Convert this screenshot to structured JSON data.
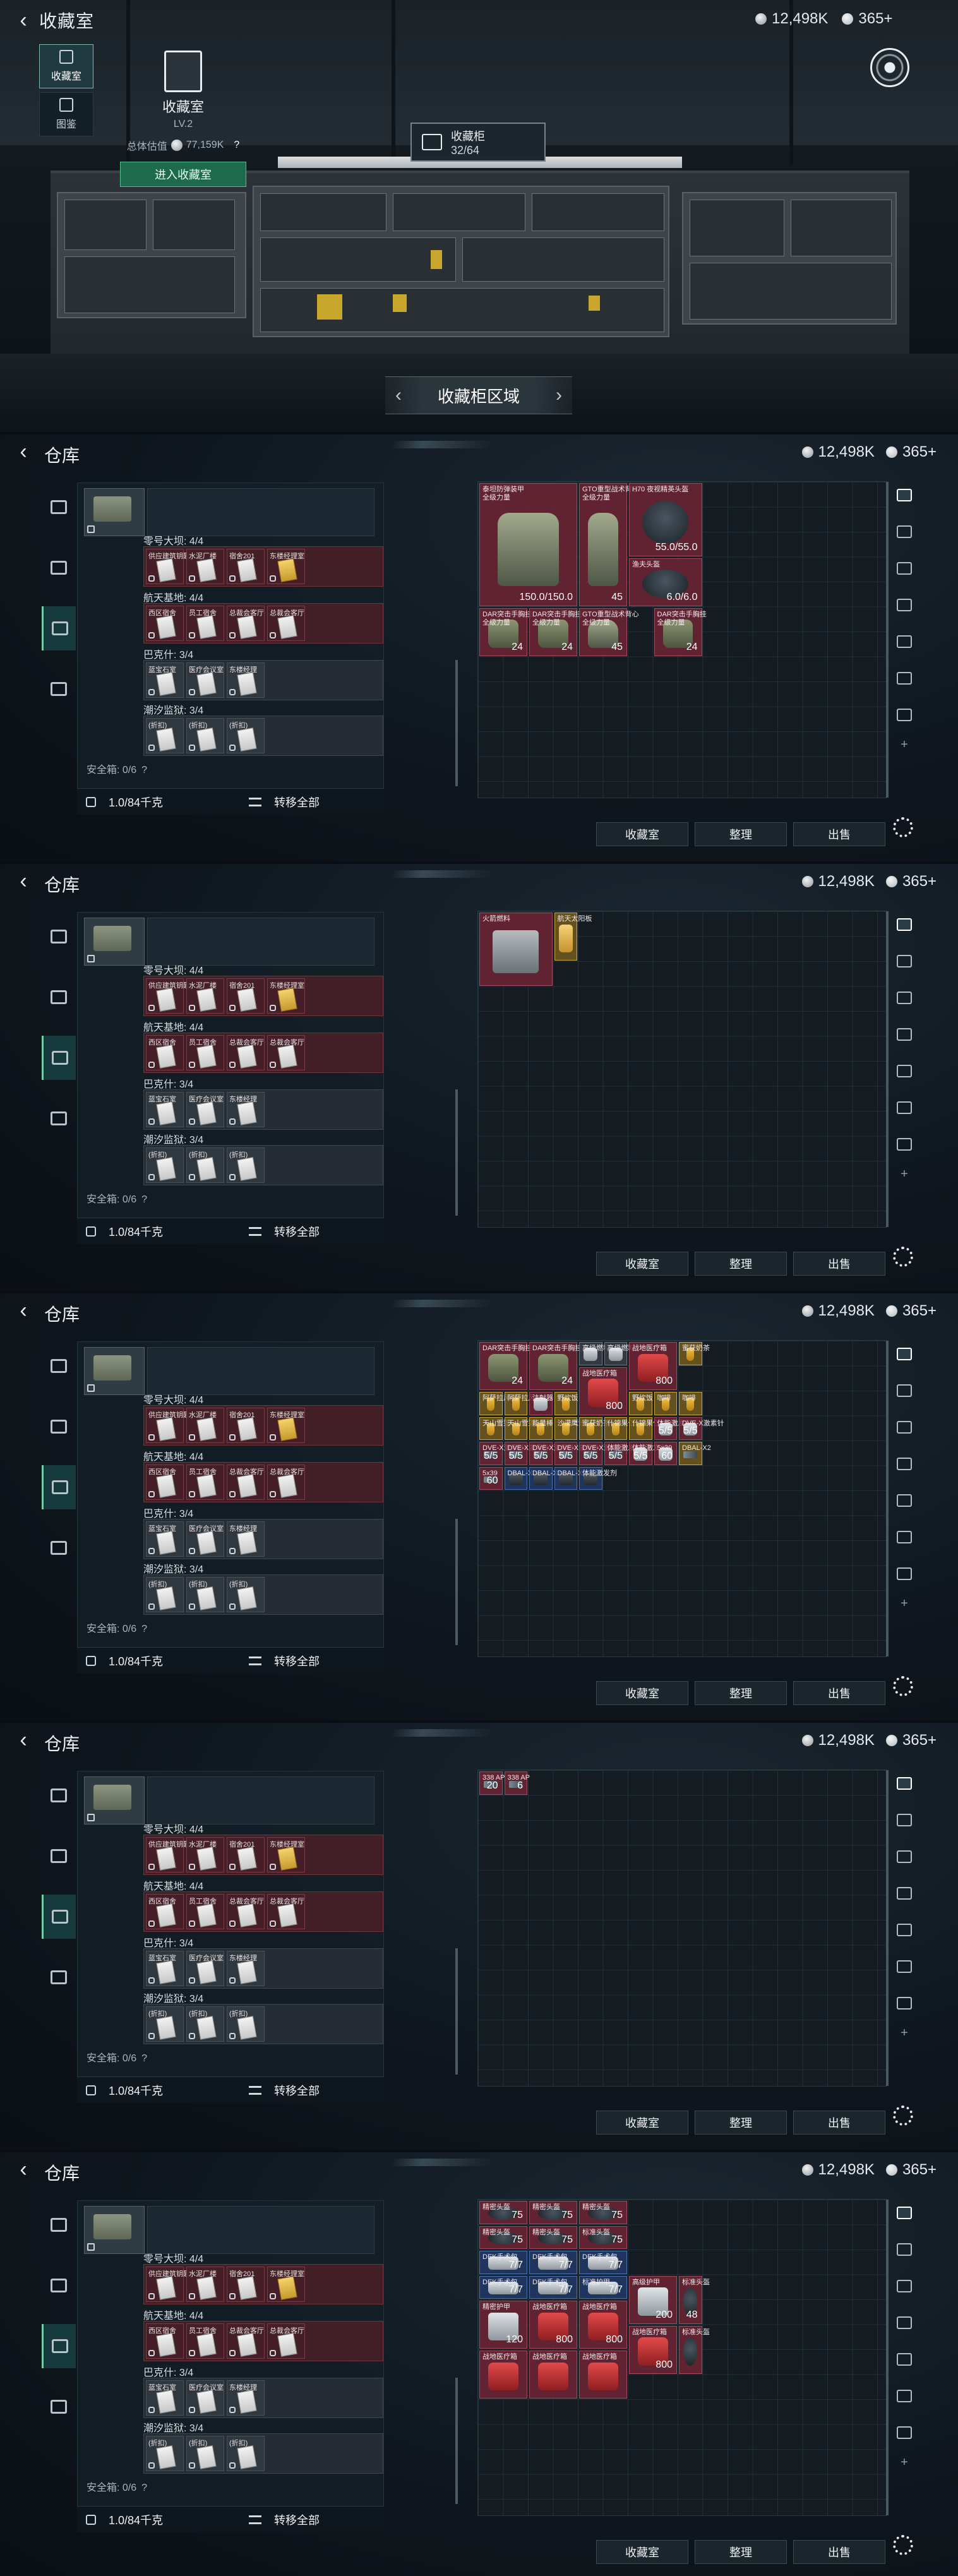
{
  "top": {
    "title": "收藏室",
    "currency": {
      "coins": "12,498K",
      "points": "365+"
    },
    "side_tabs": [
      {
        "label": "收藏室"
      },
      {
        "label": "图鉴"
      }
    ],
    "card": {
      "name": "收藏室",
      "level": "LV.2",
      "value_label": "总体估值",
      "value": "77,159K",
      "help": "?",
      "enter_button": "进入收藏室"
    },
    "cabinet": {
      "label": "收藏柜",
      "count": "32/64"
    },
    "region": {
      "label": "收藏柜区域",
      "prev": "‹",
      "next": "›"
    }
  },
  "inventory_common": {
    "title": "仓库",
    "currency": {
      "coins": "12,498K",
      "points": "365+"
    },
    "groups": [
      {
        "label": "零号大坝: 4/4",
        "items": [
          "供应建筑钥匙",
          "水泥厂楼",
          "宿舍201",
          "东楼经理室"
        ]
      },
      {
        "label": "航天基地: 4/4",
        "items": [
          "西区宿舍",
          "员工宿舍",
          "总裁会客厅",
          "总裁会客厅"
        ]
      },
      {
        "label": "巴克什: 3/4",
        "items": [
          "蓝宝石室",
          "医疗会议室",
          "东楼经理"
        ]
      },
      {
        "label": "潮汐监狱: 3/4",
        "items": [
          "(折扣)",
          "(折扣)",
          "(折扣)"
        ]
      }
    ],
    "safe_box": "安全箱: 0/6",
    "safe_help": "?",
    "capacity": "1.0/84千克",
    "transfer_all": "转移全部",
    "buttons": {
      "collection": "收藏室",
      "sort": "整理",
      "sell": "出售"
    }
  },
  "panels": [
    {
      "id": "armor",
      "slots": [
        {
          "name": "泰坦防弹装甲",
          "sub": "全级力量",
          "value": "150.0/150.0"
        },
        {
          "name": "GTO重型战术背心",
          "sub": "全级力量",
          "value": "45"
        },
        {
          "name": "H70 夜视精英头盔",
          "value": "55.0/55.0"
        },
        {
          "name": "DAR突击手胸挂",
          "sub": "全级力量",
          "value": "24"
        },
        {
          "name": "DAR突击手胸挂",
          "sub": "全级力量",
          "value": "24"
        },
        {
          "name": "GTO重型战术背心",
          "sub": "全级力量",
          "value": "45"
        },
        {
          "name": "DAR突击手胸挂",
          "sub": "全级力量",
          "value": "24"
        },
        {
          "name": "渔夫头盔",
          "value": "6.0/6.0"
        }
      ]
    },
    {
      "id": "fuel",
      "slots": [
        {
          "name": "火箭燃料"
        },
        {
          "name": "航天太阳板"
        }
      ]
    },
    {
      "id": "consumables",
      "slots": [
        {
          "name": "DAR突击手胸挂",
          "value": "24"
        },
        {
          "name": "DAR突击手胸挂",
          "value": "24"
        },
        {
          "name": "高级燃料"
        },
        {
          "name": "高级燃料"
        },
        {
          "name": "战地医疗箱",
          "value": "800"
        },
        {
          "name": "战地医疗箱",
          "value": "800"
        },
        {
          "name": "蜜获奶茶"
        },
        {
          "name": "阿萨拉风味"
        },
        {
          "name": "阿萨拉风味"
        },
        {
          "name": "注射器"
        },
        {
          "name": "野炊饭"
        },
        {
          "name": "野炊饭"
        },
        {
          "name": "咖啡"
        },
        {
          "name": "咖啡"
        },
        {
          "name": "天山雪莲"
        },
        {
          "name": "天山雪莲"
        },
        {
          "name": "能量棒"
        },
        {
          "name": "沙漠鹰汁"
        },
        {
          "name": "蜜获奶茶"
        },
        {
          "name": "什锦果仁"
        },
        {
          "name": "什锦果仁"
        },
        {
          "name": "体能激发剂",
          "value": "5/5"
        },
        {
          "name": "DVE-X激素针",
          "value": "5/5"
        },
        {
          "name": "DVE-X激素针",
          "value": "5/5"
        },
        {
          "name": "DVE-X激素针",
          "value": "5/5"
        },
        {
          "name": "DVE-X激素针",
          "value": "5/5"
        },
        {
          "name": "DVE-X激素针",
          "value": "5/5"
        },
        {
          "name": "DVE-X激素针",
          "value": "5/5"
        },
        {
          "name": "体能激发剂",
          "value": "5/5"
        },
        {
          "name": "体能激发剂",
          "value": "5/5"
        },
        {
          "name": "5x39",
          "value": "60"
        },
        {
          "name": "5x39",
          "value": "60"
        },
        {
          "name": "DBAL-X2"
        },
        {
          "name": "DBAL-X2"
        },
        {
          "name": "DBAL-X2"
        },
        {
          "name": "DBAL-X2"
        },
        {
          "name": "体能激发剂"
        }
      ]
    },
    {
      "id": "ammo",
      "slots": [
        {
          "name": "338 AP",
          "value": "20"
        },
        {
          "name": "338 AP",
          "value": "6"
        }
      ]
    },
    {
      "id": "medical",
      "slots": [
        {
          "name": "精密头盔",
          "value": "75"
        },
        {
          "name": "精密头盔",
          "value": "75"
        },
        {
          "name": "精密头盔",
          "value": "75"
        },
        {
          "name": "精密头盔",
          "value": "75"
        },
        {
          "name": "精密头盔",
          "value": "75"
        },
        {
          "name": "标准头盔",
          "value": "75"
        },
        {
          "name": "DEK手术包",
          "value": "7/7"
        },
        {
          "name": "DEK手术包",
          "value": "7/7"
        },
        {
          "name": "DEK手术包",
          "value": "7/7"
        },
        {
          "name": "DEK手术包",
          "value": "7/7"
        },
        {
          "name": "DEK手术包",
          "value": "7/7"
        },
        {
          "name": "标准护甲",
          "value": "7/7"
        },
        {
          "name": "精密护甲",
          "value": "120"
        },
        {
          "name": "战地医疗箱",
          "value": "800"
        },
        {
          "name": "战地医疗箱",
          "value": "800"
        },
        {
          "name": "高级护甲",
          "value": "200"
        },
        {
          "name": "战地医疗箱",
          "value": "800"
        },
        {
          "name": "标准头盔",
          "value": "48"
        },
        {
          "name": "战地医疗箱"
        },
        {
          "name": "战地医疗箱"
        },
        {
          "name": "战地医疗箱"
        },
        {
          "name": "标准头盔"
        }
      ]
    }
  ]
}
